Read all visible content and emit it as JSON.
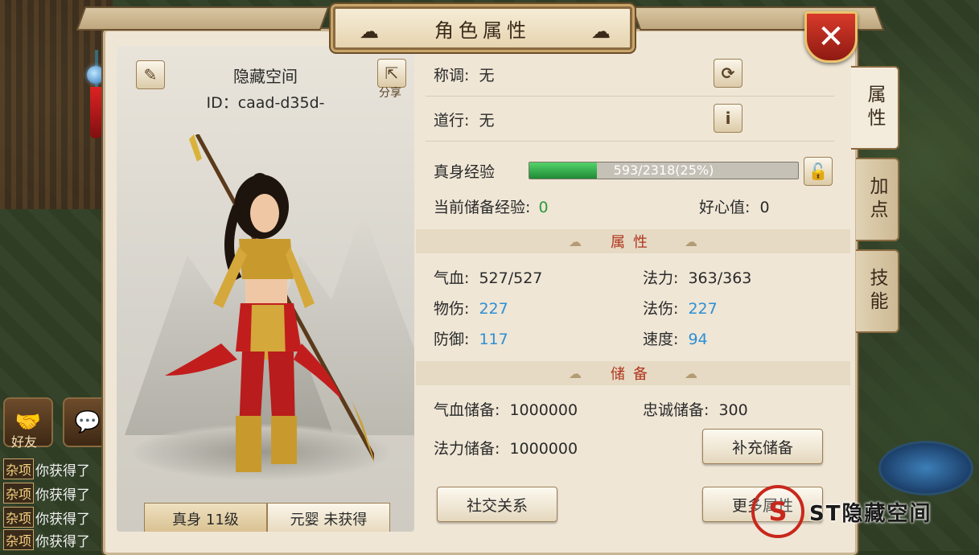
{
  "window": {
    "title": "角色属性",
    "close_label": "✕"
  },
  "side_tabs": [
    {
      "label": "属性",
      "active": true
    },
    {
      "label": "加点",
      "active": false
    },
    {
      "label": "技能",
      "active": false
    }
  ],
  "profile": {
    "name": "隐藏空间",
    "id_text": "ID：caad-d35d-",
    "share_label": "分享",
    "level_tabs": [
      "真身 11级",
      "元婴 未获得"
    ]
  },
  "info": {
    "title_label": "称调:",
    "title_value": "无",
    "dao_label": "道行:",
    "dao_value": "无",
    "exp_label": "真身经验",
    "exp_text": "593/2318(25%)",
    "exp_fraction": 0.25,
    "reserve_exp_label": "当前储备经验:",
    "reserve_exp_value": "0",
    "goodwill_label": "好心值:",
    "goodwill_value": "0"
  },
  "attributes": {
    "section_title": "属性",
    "hp_label": "气血:",
    "hp_value": "527/527",
    "mp_label": "法力:",
    "mp_value": "363/363",
    "pdmg_label": "物伤:",
    "pdmg_value": "227",
    "mdmg_label": "法伤:",
    "mdmg_value": "227",
    "def_label": "防御:",
    "def_value": "117",
    "spd_label": "速度:",
    "spd_value": "94"
  },
  "reserves": {
    "section_title": "储备",
    "hp_label": "气血储备:",
    "hp_value": "1000000",
    "loyal_label": "忠诚储备:",
    "loyal_value": "300",
    "mp_label": "法力储备:",
    "mp_value": "1000000",
    "replenish_button": "补充储备"
  },
  "buttons": {
    "social": "社交关系",
    "more": "更多属性"
  },
  "hud": {
    "friend_label": "好友",
    "chat_tag": "杂项",
    "chat_lines": [
      "你获得了",
      "你获得了",
      "你获得了",
      "你获得了"
    ]
  },
  "watermark": {
    "logo": "S",
    "text": "ST隐藏空间"
  },
  "colors": {
    "accent_red": "#b0351e",
    "value_blue": "#2d8fd6",
    "value_green": "#2b9a3a",
    "panel_bg": "#efe6d6"
  }
}
